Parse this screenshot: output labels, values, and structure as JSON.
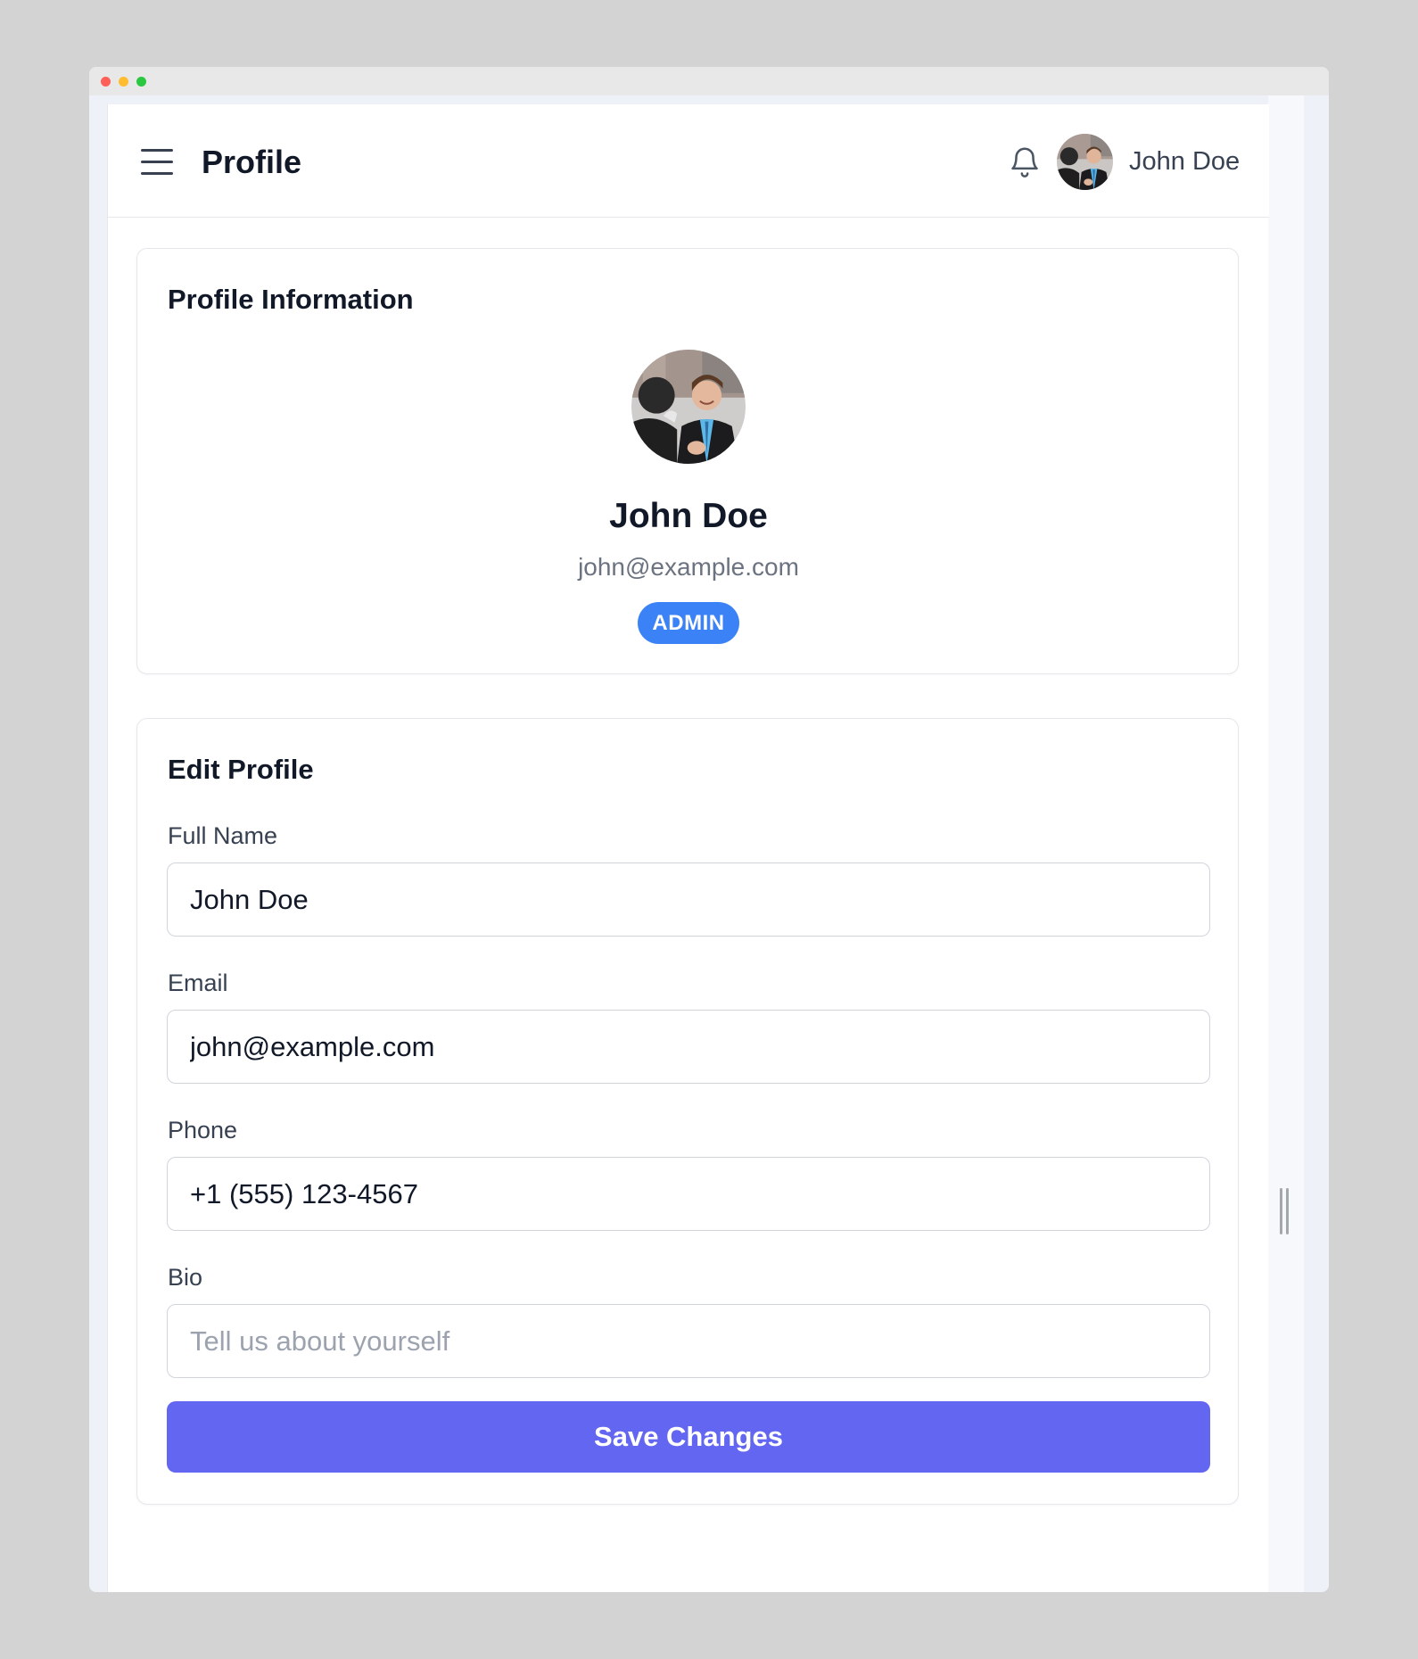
{
  "header": {
    "title": "Profile",
    "user_name": "John Doe"
  },
  "profile_card": {
    "title": "Profile Information",
    "name": "John Doe",
    "email": "john@example.com",
    "role_badge": "ADMIN"
  },
  "edit_card": {
    "title": "Edit Profile",
    "fields": [
      {
        "label": "Full Name",
        "value": "John Doe",
        "placeholder": ""
      },
      {
        "label": "Email",
        "value": "john@example.com",
        "placeholder": ""
      },
      {
        "label": "Phone",
        "value": "+1 (555) 123-4567",
        "placeholder": ""
      },
      {
        "label": "Bio",
        "value": "",
        "placeholder": "Tell us about yourself"
      }
    ],
    "save_label": "Save Changes"
  },
  "icons": {
    "menu": "hamburger-menu-icon",
    "notifications": "bell-icon"
  },
  "colors": {
    "accent": "#6366f1",
    "badge": "#3b82f6",
    "title_text": "#111827",
    "muted_text": "#6b7280"
  }
}
